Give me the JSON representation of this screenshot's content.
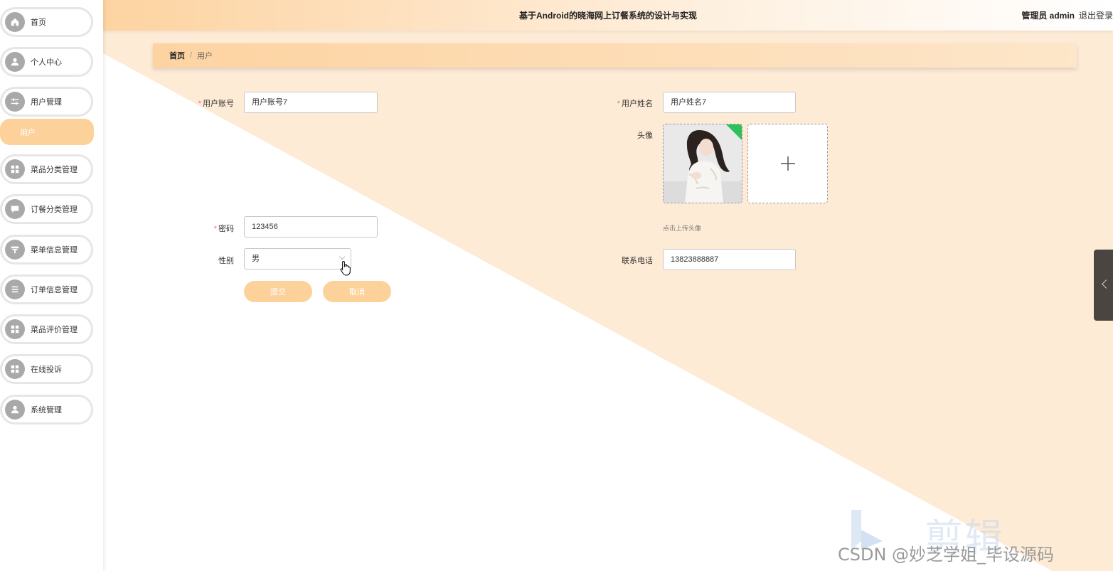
{
  "header": {
    "title": "基于Android的晓海网上订餐系统的设计与实现",
    "user": "管理员 admin",
    "logout": "退出登录"
  },
  "sidebar": {
    "items": [
      {
        "label": "首页",
        "icon": "home-icon"
      },
      {
        "label": "个人中心",
        "icon": "person-icon"
      },
      {
        "label": "用户管理",
        "icon": "sliders-icon"
      },
      {
        "label": "菜品分类管理",
        "icon": "grid-icon"
      },
      {
        "label": "订餐分类管理",
        "icon": "chat-icon"
      },
      {
        "label": "菜单信息管理",
        "icon": "tray-icon"
      },
      {
        "label": "订单信息管理",
        "icon": "list-icon"
      },
      {
        "label": "菜品评价管理",
        "icon": "grid-icon"
      },
      {
        "label": "在线投诉",
        "icon": "grid-icon"
      },
      {
        "label": "系统管理",
        "icon": "person-icon"
      }
    ],
    "active_sub": "用户"
  },
  "breadcrumb": {
    "home": "首页",
    "sep": "/",
    "current": "用户"
  },
  "form": {
    "account_label": "用户账号",
    "account_value": "用户账号7",
    "name_label": "用户姓名",
    "name_value": "用户姓名7",
    "avatar_label": "头像",
    "upload_tip": "点击上传头像",
    "password_label": "密码",
    "password_value": "123456",
    "gender_label": "性别",
    "gender_value": "男",
    "phone_label": "联系电话",
    "phone_value": "13823888887",
    "submit": "提交",
    "cancel": "取消"
  },
  "watermark": {
    "csdn": "CSDN @妙芝学姐_毕设源码",
    "brand": "剪辑"
  },
  "colors": {
    "accent": "#fdd19a",
    "required": "#f56c6c",
    "bg_peach": "#fde9d2"
  }
}
